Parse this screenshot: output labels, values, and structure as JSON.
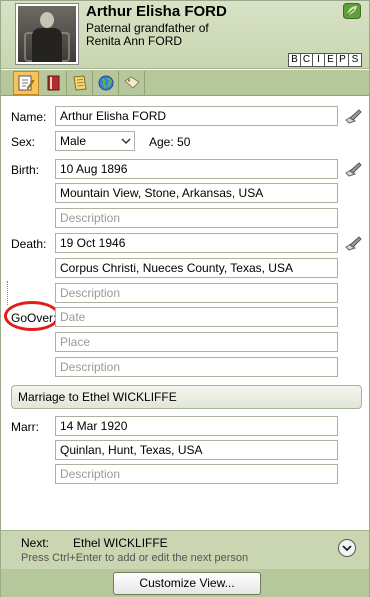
{
  "header": {
    "name": "Arthur Elisha FORD",
    "relation_line1": "Paternal grandfather of",
    "relation_line2": "Renita Ann FORD",
    "flags": [
      "B",
      "C",
      "I",
      "E",
      "P",
      "S"
    ]
  },
  "toolbar": {
    "buttons": [
      {
        "icon": "edit-icon",
        "active": true
      },
      {
        "icon": "book-icon",
        "active": false
      },
      {
        "icon": "notes-icon",
        "active": false
      },
      {
        "icon": "globe-icon",
        "active": false
      },
      {
        "icon": "tag-icon",
        "active": false
      }
    ]
  },
  "form": {
    "name_label": "Name:",
    "name_value": "Arthur Elisha FORD",
    "sex_label": "Sex:",
    "sex_value": "Male",
    "age_text": "Age: 50",
    "birth_label": "Birth:",
    "birth_date": "10 Aug 1896",
    "birth_place": "Mountain View, Stone, Arkansas, USA",
    "birth_desc_placeholder": "Description",
    "death_label": "Death:",
    "death_date": "19 Oct 1946",
    "death_place": "Corpus Christi, Nueces County, Texas, USA",
    "death_desc_placeholder": "Description",
    "goover_label": "GoOver:",
    "goover_date_placeholder": "Date",
    "goover_place_placeholder": "Place",
    "goover_desc_placeholder": "Description",
    "marriage_section": "Marriage to Ethel WICKLIFFE",
    "marr_label": "Marr:",
    "marr_date": "14 Mar 1920",
    "marr_place": "Quinlan, Hunt, Texas, USA",
    "marr_desc_placeholder": "Description"
  },
  "footer": {
    "next_label": "Next:",
    "next_name": "Ethel WICKLIFFE",
    "hint": "Press Ctrl+Enter to add or edit the next person",
    "customize_button": "Customize View..."
  },
  "colors": {
    "header_bg": "#c9d6b1",
    "toolbar_bg": "#b6c79b",
    "highlight_oval": "#e41b1b"
  }
}
